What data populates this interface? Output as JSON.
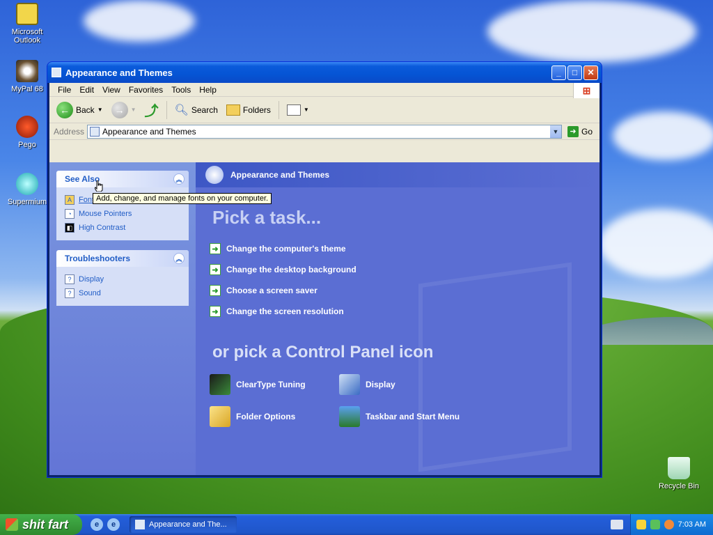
{
  "desktop": {
    "icons": [
      {
        "label": "Microsoft Outlook",
        "icon": "outlook-icon"
      },
      {
        "label": "MyPal 68",
        "icon": "mypal-icon"
      },
      {
        "label": "Pego",
        "icon": "pego-icon"
      },
      {
        "label": "Supermium",
        "icon": "supermium-icon"
      },
      {
        "label": "Recycle Bin",
        "icon": "recycle-bin-icon"
      }
    ]
  },
  "window": {
    "title": "Appearance and Themes",
    "menu": [
      "File",
      "Edit",
      "View",
      "Favorites",
      "Tools",
      "Help"
    ],
    "toolbar": {
      "back": "Back",
      "search": "Search",
      "folders": "Folders"
    },
    "address": {
      "label": "Address",
      "value": "Appearance and Themes",
      "go": "Go"
    }
  },
  "left": {
    "see_also": {
      "title": "See Also",
      "items": [
        "Fonts",
        "Mouse Pointers",
        "High Contrast"
      ]
    },
    "troubleshooters": {
      "title": "Troubleshooters",
      "items": [
        "Display",
        "Sound"
      ]
    }
  },
  "main": {
    "header": "Appearance and Themes",
    "pick_task": "Pick a task...",
    "tasks": [
      "Change the computer's theme",
      "Change the desktop background",
      "Choose a screen saver",
      "Change the screen resolution"
    ],
    "pick_icon": "or pick a Control Panel icon",
    "icons": [
      "ClearType Tuning",
      "Display",
      "Folder Options",
      "Taskbar and Start Menu"
    ]
  },
  "tooltip": "Add, change, and manage fonts on your computer.",
  "taskbar": {
    "start": "shit fart",
    "task_button": "Appearance and The...",
    "clock": "7:03 AM"
  },
  "colors": {
    "accent": "#215dc6",
    "title_bar": "#0554d4",
    "task_green": "#2b9a2b"
  }
}
